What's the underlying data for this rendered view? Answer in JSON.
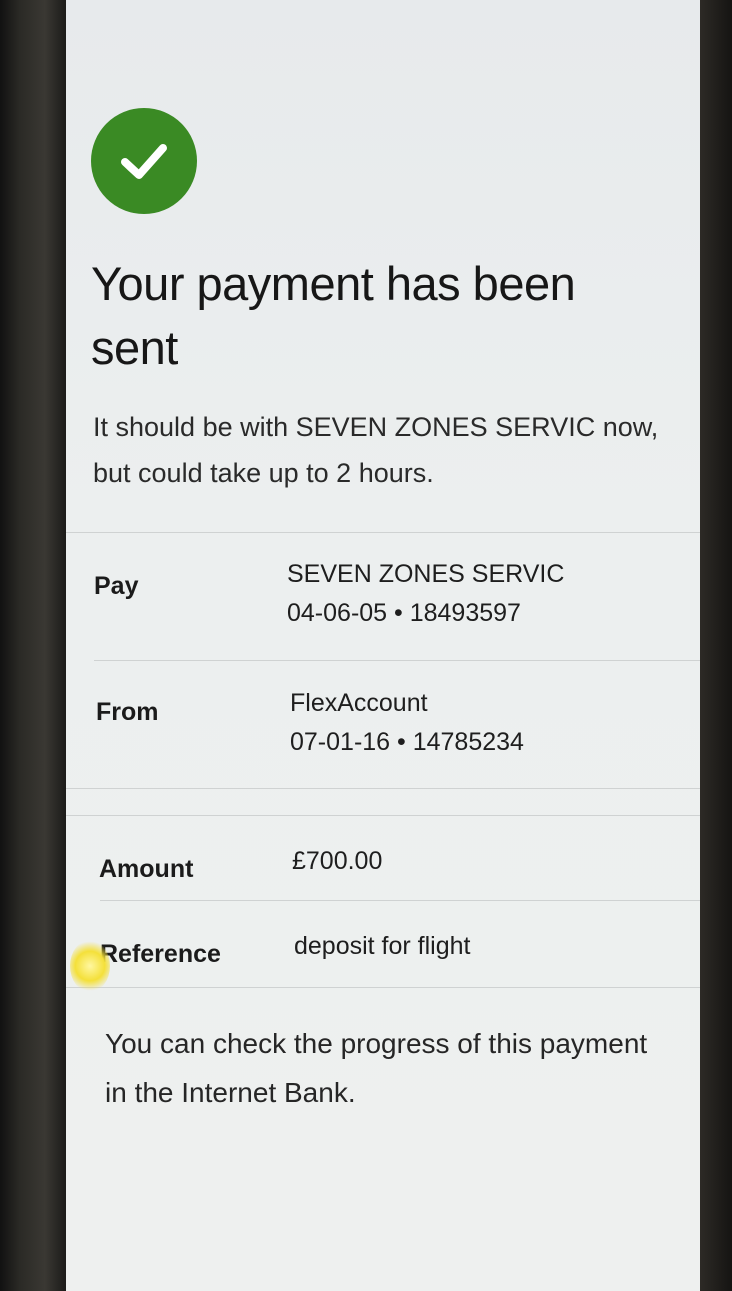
{
  "icons": {
    "status": "check-circle-icon",
    "status_color": "#3a8a24"
  },
  "header": {
    "title": "Your payment has been sent",
    "subtitle": "It should be with SEVEN ZONES SERVIC now, but could take up to 2 hours."
  },
  "details": {
    "pay": {
      "label": "Pay",
      "name": "SEVEN ZONES SERVIC",
      "account": "04-06-05 • 18493597"
    },
    "from": {
      "label": "From",
      "name": "FlexAccount",
      "account": "07-01-16 • 14785234"
    },
    "amount": {
      "label": "Amount",
      "value": "£700.00"
    },
    "reference": {
      "label": "Reference",
      "value": "deposit for flight"
    }
  },
  "footer": {
    "text": "You can check the progress of this payment in the Internet Bank."
  }
}
